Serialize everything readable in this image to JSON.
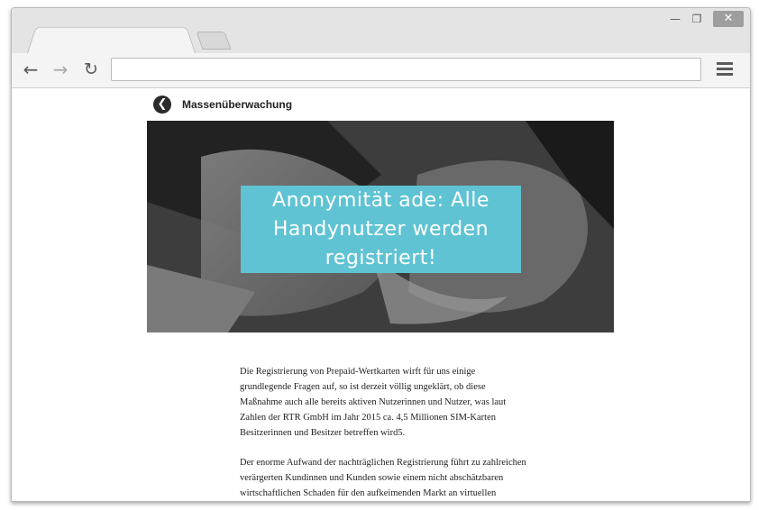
{
  "browser": {
    "address_value": "",
    "window_controls": {
      "minimize_icon": "minimize-icon",
      "maximize_icon": "maximize-icon",
      "close_icon": "close-icon"
    }
  },
  "page": {
    "section_title": "Massenüberwachung",
    "headline": "Anonymität ade: Alle Handynutzer werden registriert!",
    "paragraphs": [
      "Die Registrierung von Prepaid-Wertkarten wirft für uns einige grundlegende Fragen auf, so ist derzeit völlig ungeklärt, ob diese Maßnahme auch alle bereits aktiven Nutzerinnen und Nutzer, was laut Zahlen der RTR GmbH im Jahr 2015 ca. 4,5 Millionen SIM-Karten Besitzerinnen und Besitzer betreffen wird5.",
      "Der enorme Aufwand der nachträglichen Registrierung führt zu zahlreichen verärgerten Kundinnen und Kunden sowie einem nicht abschätzbaren wirtschaftlichen Schaden für den aufkeimenden Markt an virtuellen Mobilfunkbetreibern (MVNOs), welche erheblich zum"
    ]
  },
  "colors": {
    "headline_bg": "#5fc3d3"
  }
}
